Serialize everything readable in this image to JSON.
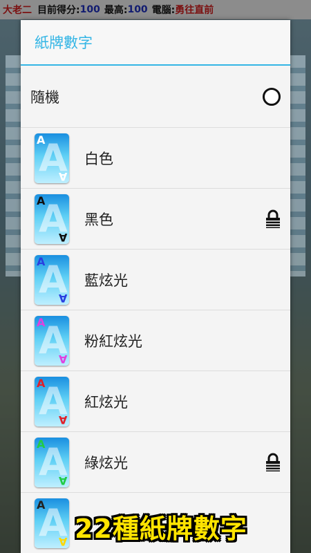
{
  "topbar": {
    "game_name": "大老二",
    "score_label": "目前得分:",
    "score_value": "100",
    "high_label": "最高:",
    "high_value": "100",
    "ai_label": "電腦:",
    "ai_value": "勇往直前"
  },
  "dialog": {
    "title": "紙牌數字",
    "random_label": "隨機",
    "options": [
      {
        "label": "白色",
        "top_color": "#ffffff",
        "bot_color": "#ffffff",
        "locked": false
      },
      {
        "label": "黑色",
        "top_color": "#111111",
        "bot_color": "#111111",
        "locked": true
      },
      {
        "label": "藍炫光",
        "top_color": "#2a3fe0",
        "bot_color": "#2a3fe0",
        "locked": false
      },
      {
        "label": "粉紅炫光",
        "top_color": "#e040e0",
        "bot_color": "#e040e0",
        "locked": false
      },
      {
        "label": "紅炫光",
        "top_color": "#e0202a",
        "bot_color": "#e0202a",
        "locked": false
      },
      {
        "label": "綠炫光",
        "top_color": "#22cc44",
        "bot_color": "#22cc44",
        "locked": true
      },
      {
        "label": "",
        "top_color": "#222222",
        "bot_color": "#ffd800",
        "locked": false
      }
    ]
  },
  "caption": "22種紙牌數字",
  "colors": {
    "accent": "#33b5e5",
    "caption": "#ffe400"
  }
}
